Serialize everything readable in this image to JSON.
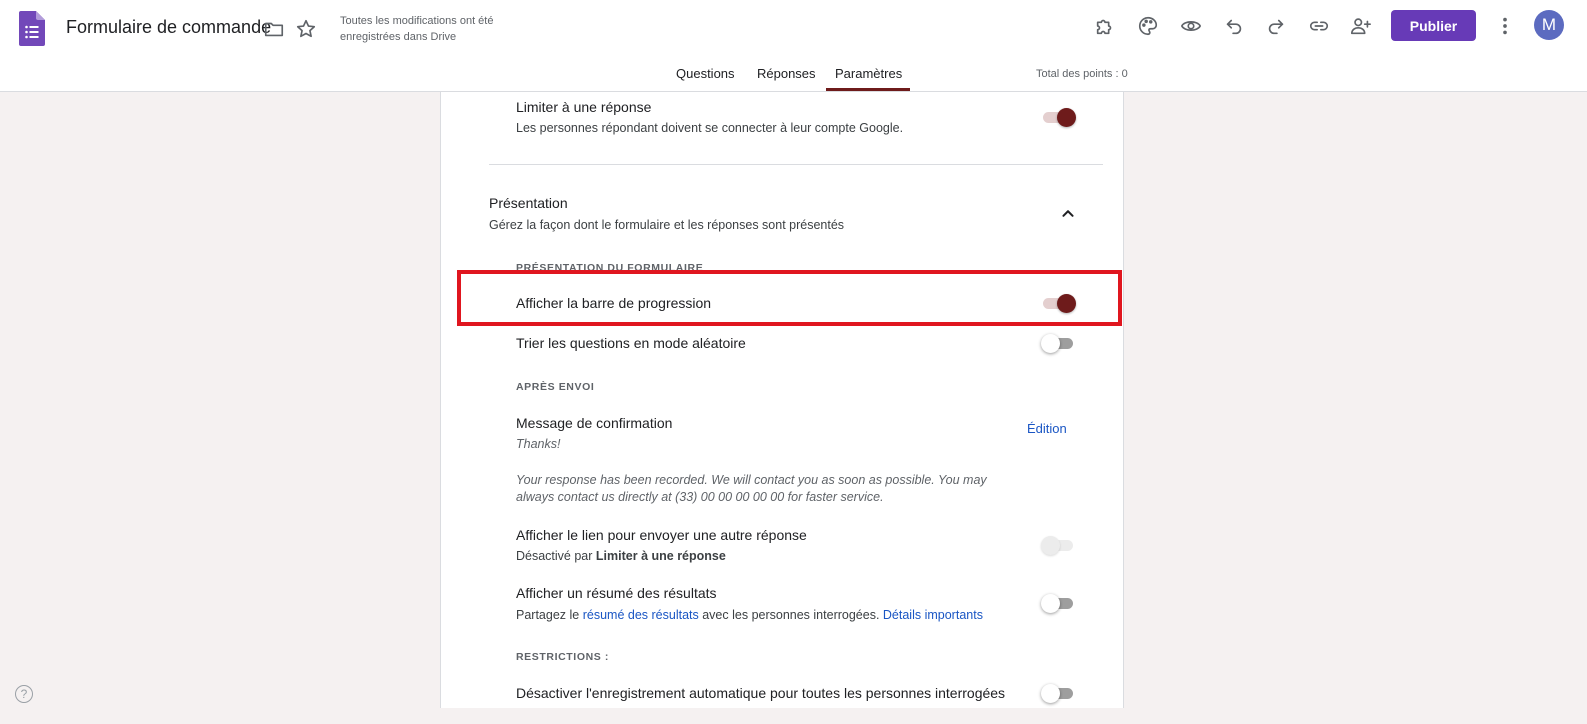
{
  "header": {
    "doc_title": "Formulaire de commande",
    "save_status": "Toutes les modifications ont été enregistrées dans Drive",
    "publish_label": "Publier",
    "avatar_letter": "M",
    "total_points": "Total des points : 0"
  },
  "tabs": [
    {
      "label": "Questions",
      "active": false
    },
    {
      "label": "Réponses",
      "active": false
    },
    {
      "label": "Paramètres",
      "active": true
    }
  ],
  "settings": {
    "limit": {
      "label": "Limiter à une réponse",
      "description": "Les personnes répondant doivent se connecter à leur compte Google.",
      "enabled": true
    },
    "presentation": {
      "title": "Présentation",
      "description": "Gérez la façon dont le formulaire et les réponses sont présentés",
      "form_overline": "PRÉSENTATION DU FORMULAIRE",
      "progress_bar": {
        "label": "Afficher la barre de progression",
        "enabled": true
      },
      "shuffle": {
        "label": "Trier les questions en mode aléatoire",
        "enabled": false
      },
      "after_overline": "APRÈS ENVOI",
      "confirmation": {
        "label": "Message de confirmation",
        "edit_label": "Édition",
        "message_line1": "Thanks!",
        "message_line2": "Your response has been recorded. We will contact you as soon as possible. You may",
        "message_line3": "always contact us directly at (33) 00 00 00 00 00 for faster service."
      },
      "another_response": {
        "label": "Afficher le lien pour envoyer une autre réponse",
        "desc_prefix": "Désactivé par",
        "desc_bold": "Limiter à une réponse",
        "enabled": false
      },
      "summary": {
        "label": "Afficher un résumé des résultats",
        "desc_prefix": "Partagez le",
        "desc_link": "résumé des résultats",
        "desc_middle": "avec les personnes interrogées.",
        "desc_link2": "Détails importants",
        "enabled": false
      },
      "restrictions_overline": "RESTRICTIONS :",
      "autosave": {
        "label": "Désactiver l'enregistrement automatique pour toutes les personnes interrogées",
        "enabled": false
      }
    }
  },
  "help_label": "?",
  "colors": {
    "accent": "#6e1b1b",
    "publish": "#673ab7",
    "highlight": "#e0161f"
  }
}
